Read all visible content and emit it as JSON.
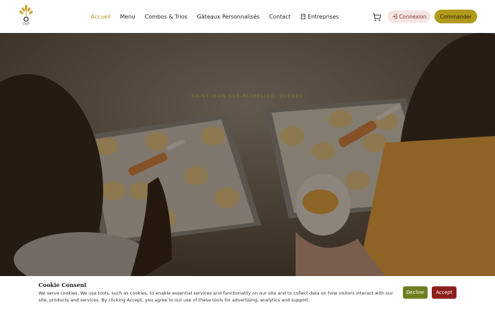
{
  "brand": {
    "name": "Ouf!"
  },
  "nav": {
    "items": [
      {
        "label": "Accueil",
        "active": true
      },
      {
        "label": "Menu",
        "active": false
      },
      {
        "label": "Combos & Trios",
        "active": false
      },
      {
        "label": "Gâteaux Personnalisés",
        "active": false
      },
      {
        "label": "Contact",
        "active": false
      }
    ],
    "enterprises": "Entreprises"
  },
  "actions": {
    "login": "Connexion",
    "order": "Commander"
  },
  "hero": {
    "subtitle": "SAINT-JEAN-SUR-RICHELIEU, QUÉBEC"
  },
  "cookie": {
    "title": "Cookie Consent",
    "text": "We serve cookies. We use tools, such as cookies, to enable essential services and functionality on our site and to collect data on how visitors interact with our site, products and services. By clicking Accept, you agree to our use of these tools for advertising, analytics and support.",
    "decline": "Decline",
    "accept": "Accept"
  },
  "colors": {
    "accent": "#b09a1c",
    "login_bg": "#f5e4e4",
    "decline": "#6f7f1f",
    "accept": "#8e1f1f"
  }
}
